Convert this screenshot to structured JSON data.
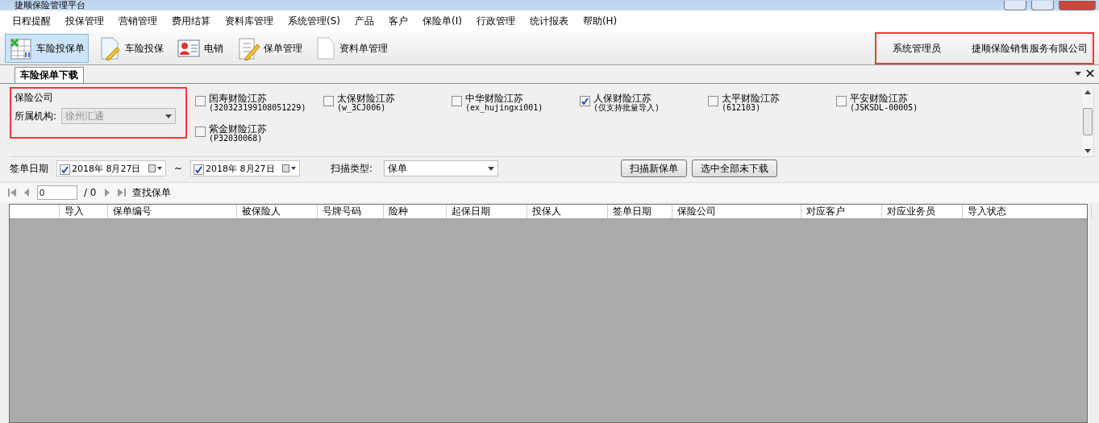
{
  "window": {
    "title": "捷顺保险管理平台"
  },
  "menu": [
    "日程提醒",
    "投保管理",
    "营销管理",
    "费用结算",
    "资料库管理",
    "系统管理(S)",
    "产品",
    "客户",
    "保险单(I)",
    "行政管理",
    "统计报表",
    "帮助(H)"
  ],
  "toolbar": [
    {
      "label": "车险投保单",
      "kind": "table",
      "selected": true
    },
    {
      "label": "车险投保",
      "kind": "pencil",
      "selected": false
    },
    {
      "label": "电销",
      "kind": "contact",
      "selected": false
    },
    {
      "label": "保单管理",
      "kind": "checklist",
      "selected": false
    },
    {
      "label": "资料单管理",
      "kind": "document",
      "selected": false
    }
  ],
  "user": {
    "role": "系统管理员",
    "company": "捷顺保险销售服务有限公司"
  },
  "tabs": [
    {
      "label": "车险保单下载",
      "selected": true
    }
  ],
  "filter": {
    "group_title": "保险公司",
    "org_label": "所属机构:",
    "org_value": "徐州汇通",
    "companies": [
      {
        "name": "国寿财险江苏",
        "code": "(320323199108051229)",
        "checked": false
      },
      {
        "name": "太保财险江苏",
        "code": "(w_3CJ006)",
        "checked": false
      },
      {
        "name": "中华财险江苏",
        "code": "(ex_hujingxi001)",
        "checked": false
      },
      {
        "name": "人保财险江苏",
        "code": "(仅支持批量导入)",
        "checked": true
      },
      {
        "name": "太平财险江苏",
        "code": "(612103)",
        "checked": false
      },
      {
        "name": "平安财险江苏",
        "code": "(JSKSDL-00005)",
        "checked": false
      },
      {
        "name": "紫金财险江苏",
        "code": "(P32030068)",
        "checked": false
      }
    ],
    "date_label": "签单日期",
    "date_from": {
      "checked": true,
      "value": "2018年  8月27日"
    },
    "range_sep": "~",
    "date_to": {
      "checked": true,
      "value": "2018年  8月27日"
    },
    "scan_label": "扫描类型:",
    "scan_value": "保单",
    "buttons": [
      "扫描新保单",
      "选中全部未下载"
    ]
  },
  "navigator": {
    "page": "0",
    "total": "/ 0",
    "find": "查找保单"
  },
  "table": {
    "columns": [
      "导入",
      "保单编号",
      "被保险人",
      "号牌号码",
      "险种",
      "起保日期",
      "投保人",
      "签单日期",
      "保险公司",
      "对应客户",
      "对应业务员",
      "导入状态"
    ]
  }
}
